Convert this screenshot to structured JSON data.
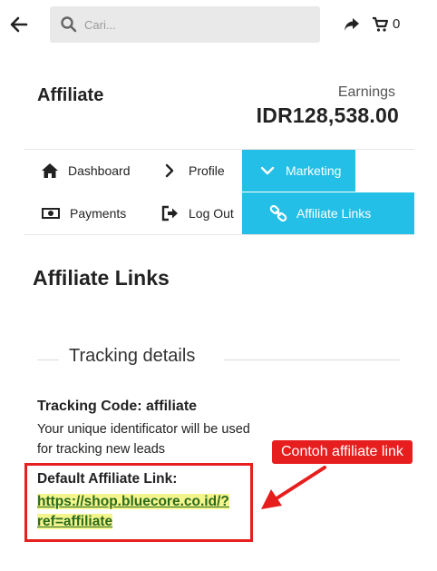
{
  "header": {
    "search_placeholder": "Cari...",
    "cart_count": "0"
  },
  "account": {
    "title": "Affiliate",
    "earnings_label": "Earnings",
    "earnings_value": "IDR128,538.00"
  },
  "menu": {
    "items": [
      {
        "label": "Dashboard",
        "icon": "home-icon"
      },
      {
        "label": "Profile",
        "icon": "chevron-right-icon"
      },
      {
        "label": "Marketing",
        "icon": "chevron-down-icon",
        "active": true
      },
      {
        "label": "Payments",
        "icon": "money-icon"
      },
      {
        "label": "Log Out",
        "icon": "sign-out-icon"
      },
      {
        "label": "Affiliate Links",
        "icon": "link-icon",
        "active": true
      }
    ]
  },
  "page": {
    "title": "Affiliate Links",
    "section_legend": "Tracking details",
    "tracking_code_label": "Tracking Code: affiliate",
    "tracking_desc": "Your unique identificator will be used for tracking new leads",
    "default_link_label": "Default Affiliate Link:",
    "default_link_url": "https://shop.bluecore.co.id/?ref=affiliate"
  },
  "annotation": {
    "callout_text": "Contoh affiliate link"
  },
  "colors": {
    "accent": "#24bfe6",
    "annotation_red": "#e62020",
    "link_highlight": "#f5f58d"
  }
}
